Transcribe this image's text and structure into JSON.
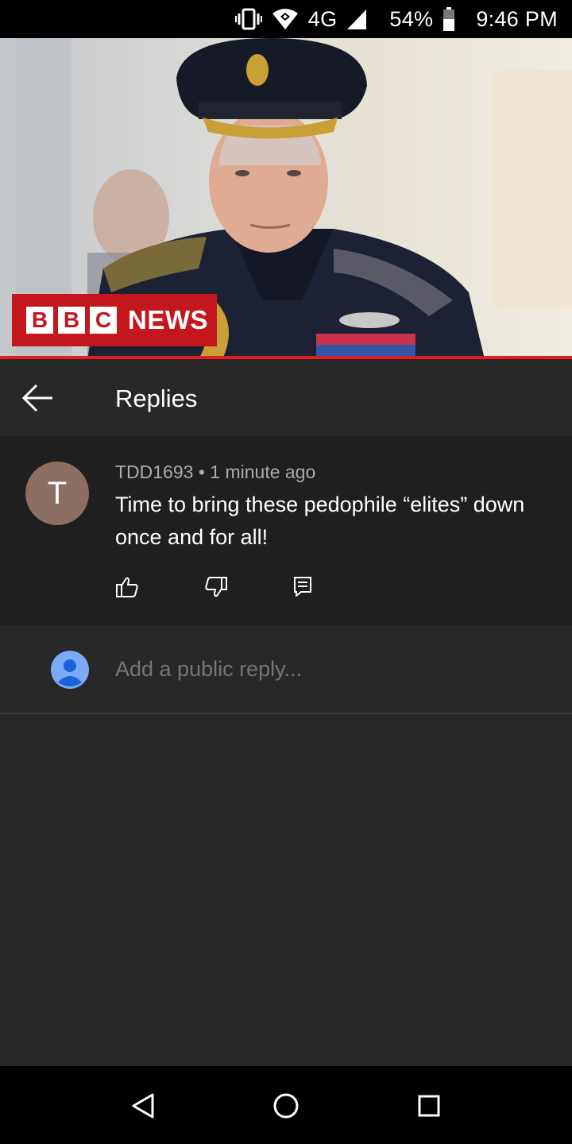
{
  "status_bar": {
    "network": "4G",
    "battery": "54%",
    "time": "9:46 PM",
    "icons": [
      "vibrate-icon",
      "wifi-icon",
      "signal-icon",
      "battery-icon"
    ]
  },
  "video": {
    "brand_box_letters": [
      "B",
      "B",
      "C"
    ],
    "brand_word": "NEWS"
  },
  "replies_panel": {
    "title": "Replies",
    "back_icon": "back-arrow-icon",
    "close_icon": "close-icon"
  },
  "comment": {
    "avatar_letter": "T",
    "author": "TDD1693",
    "separator": "•",
    "time_ago": "1 minute ago",
    "text": "Time to bring these pedophile “elites” down once and for all!",
    "actions": [
      "like-icon",
      "dislike-icon",
      "reply-icon"
    ]
  },
  "reply_input": {
    "placeholder": "Add a public reply..."
  },
  "nav_bar": {
    "buttons": [
      "back-nav-icon",
      "home-nav-icon",
      "recents-nav-icon"
    ]
  },
  "colors": {
    "panel_bg": "#282828",
    "comment_bg": "#1f1f1f",
    "bbc_red": "#c4171d",
    "progress_red": "#e61c1c",
    "avatar_brown": "#8d6e63",
    "user_avatar_blue": "#7baaf7"
  }
}
